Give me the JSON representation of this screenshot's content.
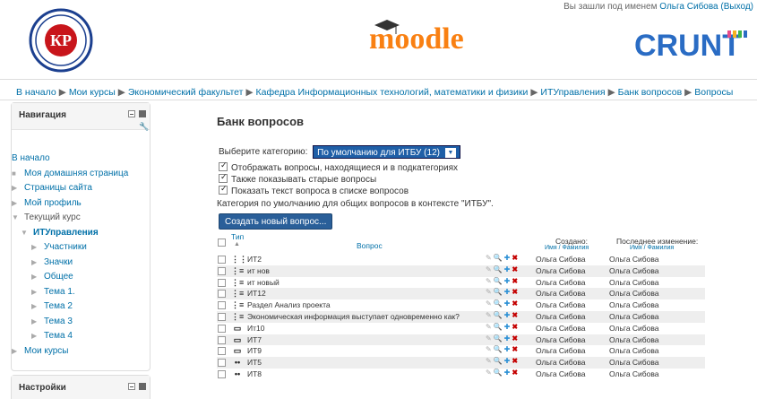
{
  "header": {
    "logged_in_prefix": "Вы зашли под именем",
    "user_name": "Ольга Сибова",
    "logout": "(Выход)",
    "moodle_logo_text": "moodle",
    "crunt_logo_text": "CRUNT",
    "left_logo_text": "КР"
  },
  "breadcrumb": [
    "В начало",
    "Мои курсы",
    "Экономический факультет",
    "Кафедра Информационных технологий, математики и физики",
    "ИТУправления",
    "Банк вопросов",
    "Вопросы"
  ],
  "navigation": {
    "title": "Навигация",
    "items": [
      {
        "label": "В начало",
        "marker": ""
      },
      {
        "label": "Моя домашняя страница",
        "marker": "■"
      },
      {
        "label": "Страницы сайта",
        "marker": "▶"
      },
      {
        "label": "Мой профиль",
        "marker": "▶"
      },
      {
        "label": "Текущий курс",
        "marker": "▼"
      },
      {
        "label": "ИТУправления",
        "marker": "▼"
      },
      {
        "label": "Участники",
        "marker": "▶"
      },
      {
        "label": "Значки",
        "marker": "▶"
      },
      {
        "label": "Общее",
        "marker": "▶"
      },
      {
        "label": "Тема 1.",
        "marker": "▶"
      },
      {
        "label": "Тема 2",
        "marker": "▶"
      },
      {
        "label": "Тема 3",
        "marker": "▶"
      },
      {
        "label": "Тема 4",
        "marker": "▶"
      },
      {
        "label": "Мои курсы",
        "marker": "▶"
      }
    ]
  },
  "settings": {
    "title": "Настройки"
  },
  "main": {
    "title": "Банк вопросов",
    "category_label": "Выберите категорию:",
    "category_value": "По умолчанию для ИТБУ (12)",
    "options": [
      "Отображать вопросы, находящиеся и в подкатегориях",
      "Также показывать старые вопросы",
      "Показать текст вопроса в списке вопросов"
    ],
    "category_note": "Категория по умолчанию для общих вопросов в контексте \"ИТБУ\".",
    "create_button": "Создать новый вопрос..."
  },
  "table": {
    "col_type": "Тип",
    "col_question": "Вопрос",
    "col_created": "Создано:",
    "col_created_sub": "Имя / Фамилия",
    "col_modified": "Последнее изменение:",
    "col_modified_sub": "Имя / Фамилия",
    "rows": [
      {
        "icon": "⋮⋮",
        "name": "ИТ2",
        "creator": "Ольга Сибова",
        "modifier": "Ольга Сибова"
      },
      {
        "icon": "⋮≡",
        "name": "ит нов",
        "creator": "Ольга Сибова",
        "modifier": "Ольга Сибова"
      },
      {
        "icon": "⋮≡",
        "name": "ит новый",
        "creator": "Ольга Сибова",
        "modifier": "Ольга Сибова"
      },
      {
        "icon": "⋮≡",
        "name": "ИТ12",
        "creator": "Ольга Сибова",
        "modifier": "Ольга Сибова"
      },
      {
        "icon": "⋮≡",
        "name": "Раздел Анализ проекта",
        "creator": "Ольга Сибова",
        "modifier": "Ольга Сибова"
      },
      {
        "icon": "⋮≡",
        "name": "Экономическая информация выступает одновременно как?",
        "creator": "Ольга Сибова",
        "modifier": "Ольга Сибова"
      },
      {
        "icon": "▭",
        "name": "Ит10",
        "creator": "Ольга Сибова",
        "modifier": "Ольга Сибова"
      },
      {
        "icon": "▭",
        "name": "ИТ7",
        "creator": "Ольга Сибова",
        "modifier": "Ольга Сибова"
      },
      {
        "icon": "▭",
        "name": "ИТ9",
        "creator": "Ольга Сибова",
        "modifier": "Ольга Сибова"
      },
      {
        "icon": "••",
        "name": "ИТ5",
        "creator": "Ольга Сибова",
        "modifier": "Ольга Сибова"
      },
      {
        "icon": "••",
        "name": "ИТ8",
        "creator": "Ольга Сибова",
        "modifier": "Ольга Сибова"
      }
    ]
  },
  "colors": {
    "link": "#0070a8",
    "select_bg": "#1f5fa7",
    "button_bg": "#2a5f99",
    "delete_icon": "#c40000",
    "move_icon": "#2a8fd5",
    "moodle_orange": "#f98012",
    "crunt_blue": "#2a6cc4"
  }
}
